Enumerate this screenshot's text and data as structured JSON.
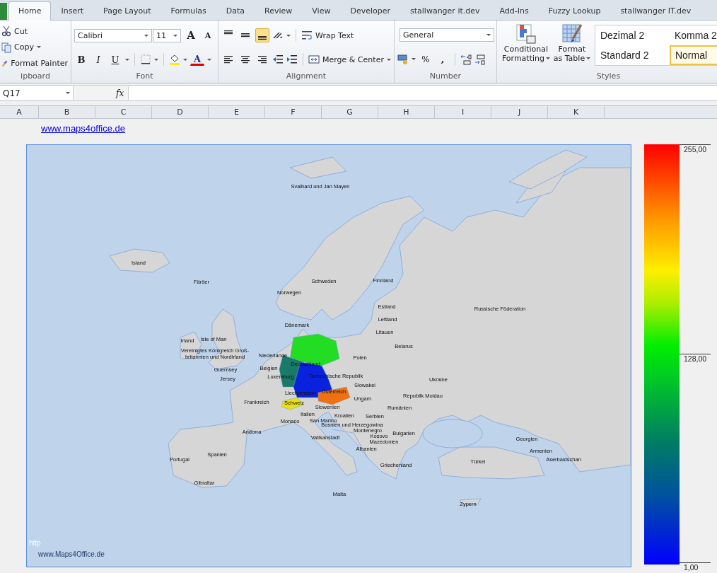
{
  "ribbon_tabs": [
    {
      "label": "Home",
      "selected": true
    },
    {
      "label": "Insert",
      "selected": false
    },
    {
      "label": "Page Layout",
      "selected": false
    },
    {
      "label": "Formulas",
      "selected": false
    },
    {
      "label": "Data",
      "selected": false
    },
    {
      "label": "Review",
      "selected": false
    },
    {
      "label": "View",
      "selected": false
    },
    {
      "label": "Developer",
      "selected": false
    },
    {
      "label": "stallwanger it.dev",
      "selected": false
    },
    {
      "label": "Add-Ins",
      "selected": false
    },
    {
      "label": "Fuzzy Lookup",
      "selected": false
    },
    {
      "label": "stallwanger IT.dev",
      "selected": false
    }
  ],
  "clipboard": {
    "items": [
      "Cut",
      "Copy",
      "Format Painter"
    ],
    "group_label": "ipboard"
  },
  "font": {
    "name": "Calibri",
    "size": "11",
    "grow": "A",
    "shrink": "A",
    "bold": "B",
    "italic": "I",
    "underline": "U",
    "font_color": "A",
    "group_label": "Font"
  },
  "alignment": {
    "vertical": [
      {
        "kind": "top",
        "selected": false
      },
      {
        "kind": "middle",
        "selected": false
      },
      {
        "kind": "bottom",
        "selected": true
      }
    ],
    "wrap_text": "Wrap Text",
    "merge_center": "Merge & Center",
    "group_label": "Alignment"
  },
  "number": {
    "format": "General",
    "percent": "%",
    "comma": ",",
    "group_label": "Number"
  },
  "styles": {
    "conditional_formatting": [
      "Conditional",
      "Formatting"
    ],
    "format_as_table": [
      "Format",
      "as Table"
    ],
    "gallery": [
      {
        "label": "Dezimal 2",
        "selected": false
      },
      {
        "label": "Komma 2",
        "selected": false
      },
      {
        "label": "Standard 2",
        "selected": false
      },
      {
        "label": "Normal",
        "selected": true
      }
    ],
    "group_label": "Styles"
  },
  "formula_bar": {
    "name_box": "Q17",
    "fx": "fx"
  },
  "columns": [
    "A",
    "B",
    "C",
    "D",
    "E",
    "F",
    "G",
    "H",
    "I",
    "J",
    "K"
  ],
  "link": "www.maps4office.de",
  "map": {
    "labels": [
      "Svalbard und Jan Mayen",
      "Island",
      "Färöer",
      "Schweden",
      "Finnland",
      "Norwegen",
      "Russische Föderation",
      "Estland",
      "Lettland",
      "Litauen",
      "Dänemark",
      "Irland",
      "Isle of Man",
      "Vereinigtes Königreich Groß-",
      "britannien und Nordirland",
      "Belarus",
      "Niederlande",
      "Polen",
      "Deutschland",
      "Guernsey",
      "Belgien",
      "Jersey",
      "Luxemburg",
      "Tschechische Republik",
      "Slowakei",
      "Ukraine",
      "Liechtenstein",
      "Österreich",
      "Republik Moldau",
      "Ungarn",
      "Frankreich",
      "Schweiz",
      "Slowenien",
      "Rumänien",
      "Italien",
      "Kroatien",
      "Serbien",
      "Monaco",
      "San Marino",
      "Bosnien und Herzegowina",
      "Montenegro",
      "Kosovo",
      "Bulgarien",
      "Mazedonien",
      "Andorra",
      "Vatikanstadt",
      "Georgien",
      "Armenien",
      "Spanien",
      "Portugal",
      "Türkei",
      "Aserbaidschan",
      "Albanien",
      "Griechenland",
      "Gibraltar",
      "Malta",
      "Zypern"
    ],
    "faint_text": "http",
    "credit": "www.Maps4Office.de"
  },
  "legend": {
    "max": "255,00",
    "mid": "128,00",
    "min": "1,00"
  }
}
